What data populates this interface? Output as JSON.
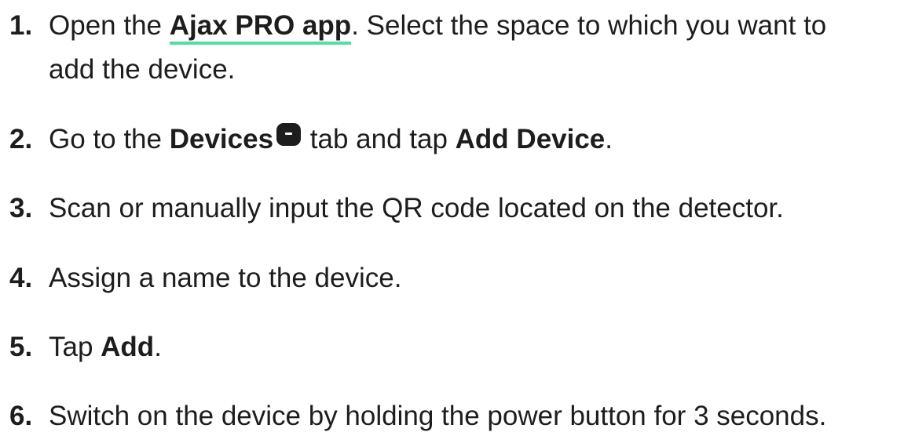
{
  "steps": [
    {
      "number": "1.",
      "text_before": "Open the ",
      "link": "Ajax PRO app",
      "text_after": ". Select the space to which you want to",
      "line2": "add the device."
    },
    {
      "number": "2.",
      "text_before": "Go to the ",
      "bold1": "Devices",
      "icon": "devices-icon",
      "text_middle": " tab and tap ",
      "bold2": "Add Device",
      "text_after": "."
    },
    {
      "number": "3.",
      "text": "Scan or manually input the QR code located on the detector."
    },
    {
      "number": "4.",
      "text": "Assign a name to the device."
    },
    {
      "number": "5.",
      "text_before": "Tap ",
      "bold": "Add",
      "text_after": "."
    },
    {
      "number": "6.",
      "text": "Switch on the device by holding the power button for 3 seconds."
    }
  ],
  "colors": {
    "text": "#1d1d1d",
    "link_underline": "#4fe0a2",
    "background": "#ffffff"
  }
}
